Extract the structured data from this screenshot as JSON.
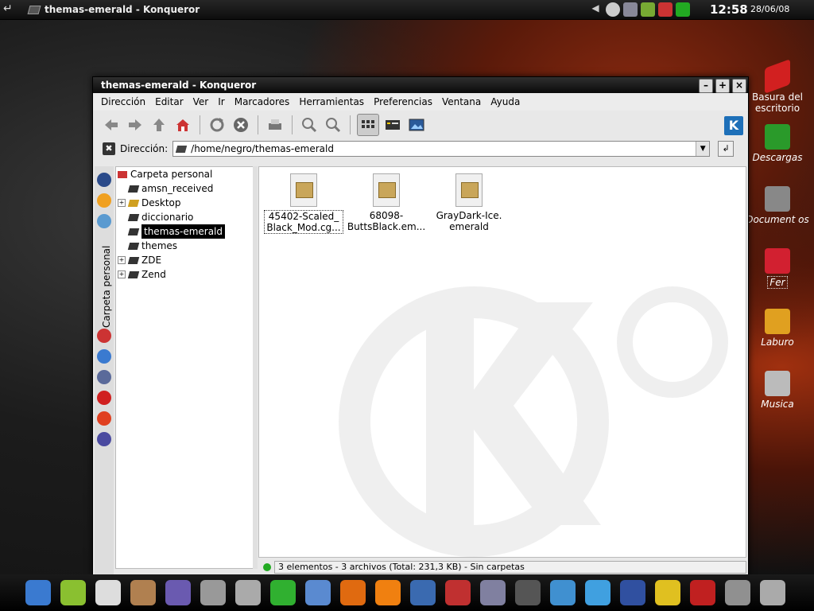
{
  "top_panel": {
    "task_title": "themas-emerald - Konqueror",
    "clock": "12:58",
    "date": "28/06/08"
  },
  "desktop_icons": [
    {
      "label": "Basura del escritorio",
      "icon": "trash-full-icon",
      "color": "#d22020"
    },
    {
      "label": "Descargas",
      "icon": "download-folder-icon",
      "color": "#2a9a2a"
    },
    {
      "label": "Document os",
      "icon": "documents-folder-icon",
      "color": "#888888"
    },
    {
      "label": "Fer",
      "icon": "heart-folder-icon",
      "color": "#d22030"
    },
    {
      "label": "Laburo",
      "icon": "work-folder-icon",
      "color": "#e0a020"
    },
    {
      "label": "Musica",
      "icon": "music-folder-icon",
      "color": "#bbbbbb"
    }
  ],
  "window": {
    "title": "themas-emerald - Konqueror",
    "menu": [
      "Dirección",
      "Editar",
      "Ver",
      "Ir",
      "Marcadores",
      "Herramientas",
      "Preferencias",
      "Ventana",
      "Ayuda"
    ],
    "location_label": "Dirección:",
    "location_value": "/home/negro/themas-emerald"
  },
  "sidebar": {
    "tab_label": "Carpeta personal",
    "tree": [
      {
        "label": "Carpeta personal",
        "expander": false,
        "selected": false
      },
      {
        "label": "amsn_received",
        "expander": false,
        "selected": false
      },
      {
        "label": "Desktop",
        "expander": true,
        "selected": false
      },
      {
        "label": "diccionario",
        "expander": false,
        "selected": false
      },
      {
        "label": "themas-emerald",
        "expander": false,
        "selected": true
      },
      {
        "label": "themes",
        "expander": false,
        "selected": false
      },
      {
        "label": "ZDE",
        "expander": true,
        "selected": false
      },
      {
        "label": "Zend",
        "expander": true,
        "selected": false
      }
    ]
  },
  "files": [
    {
      "line1": "45402-Scaled_",
      "line2": "Black_Mod.cg...",
      "focused": true
    },
    {
      "line1": "68098-",
      "line2": "ButtsBlack.em...",
      "focused": false
    },
    {
      "line1": "GrayDark-Ice.",
      "line2": "emerald",
      "focused": false
    }
  ],
  "status_text": "3 elementos - 3 archivos (Total: 231,3 KB) - Sin carpetas",
  "taskbar_launchers": [
    {
      "icon": "kde-menu-icon",
      "color": "#3a7ad0"
    },
    {
      "icon": "user-icon",
      "color": "#8ac030"
    },
    {
      "icon": "amarok-icon",
      "color": "#dddddd"
    },
    {
      "icon": "rabbit-icon",
      "color": "#b08050"
    },
    {
      "icon": "terminal-monitor-icon",
      "color": "#6a5ab0"
    },
    {
      "icon": "notes-icon",
      "color": "#999999"
    },
    {
      "icon": "scanner-icon",
      "color": "#aaaaaa"
    },
    {
      "icon": "green-ball-icon",
      "color": "#30b030"
    },
    {
      "icon": "editor-icon",
      "color": "#5a8ad0"
    },
    {
      "icon": "firefox-icon",
      "color": "#e06a10"
    },
    {
      "icon": "vlc-icon",
      "color": "#f08010"
    },
    {
      "icon": "thunderbird-icon",
      "color": "#3a6ab0"
    },
    {
      "icon": "home-icon",
      "color": "#c03030"
    },
    {
      "icon": "config-icon",
      "color": "#8080a0"
    },
    {
      "icon": "terminal-icon",
      "color": "#555555"
    },
    {
      "icon": "image-viewer-icon",
      "color": "#4090d0"
    },
    {
      "icon": "messenger-icon",
      "color": "#40a0e0"
    },
    {
      "icon": "globe-icon",
      "color": "#3050a0"
    },
    {
      "icon": "chat-icon",
      "color": "#e0c020"
    },
    {
      "icon": "stats-icon",
      "color": "#c02020"
    },
    {
      "icon": "brush-icon",
      "color": "#909090"
    },
    {
      "icon": "trash-icon",
      "color": "#aaaaaa"
    }
  ]
}
